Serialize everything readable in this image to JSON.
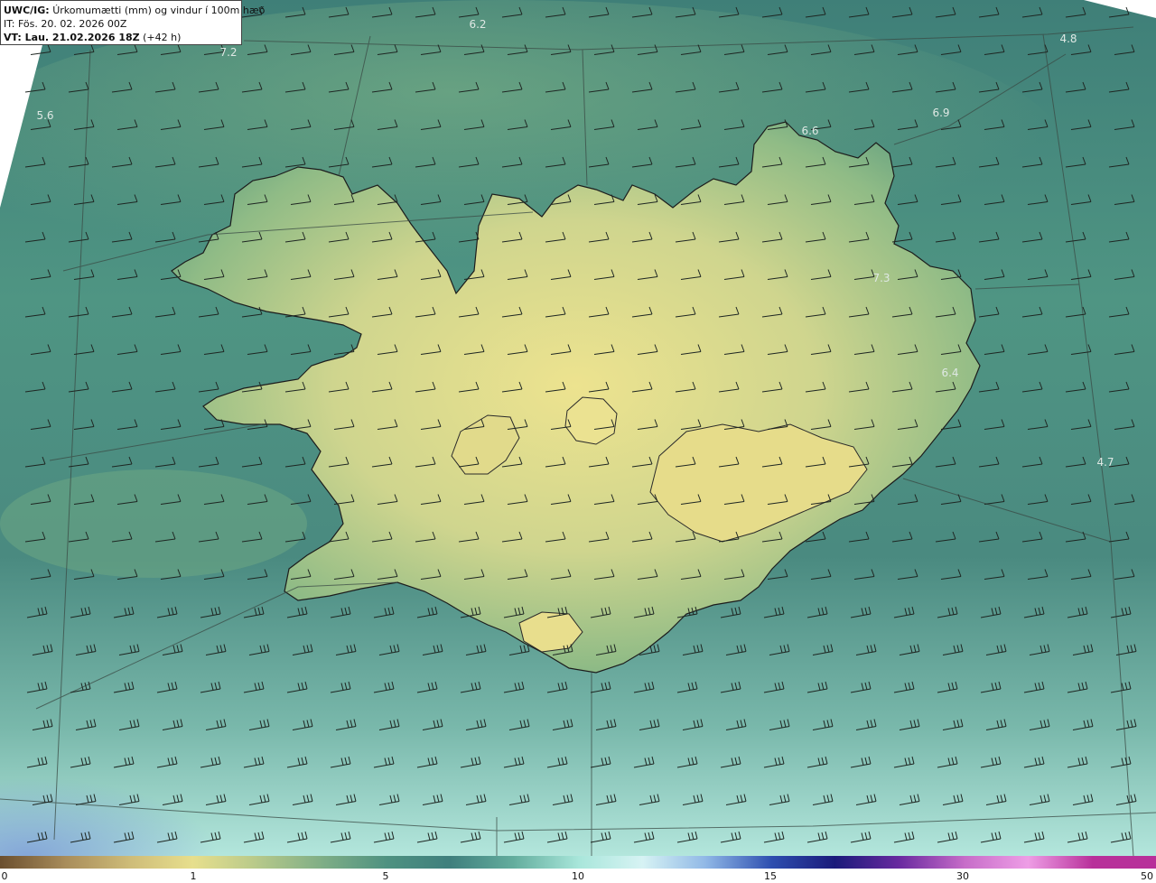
{
  "header": {
    "product_code": "UWC/IG:",
    "title": "Úrkomumætti (mm) og vindur í 100m hæð",
    "issue_time": "IT: Fös. 20. 02. 2026 00Z",
    "valid_prefix": "VT: Lau. 21.02.2026 18Z",
    "valid_suffix": "(+42 h)"
  },
  "value_labels": [
    "6.2",
    "4.8",
    "7.2",
    "5.6",
    "6.9",
    "6.6",
    "7.3",
    "6.4",
    "4.7"
  ],
  "colorbar": {
    "ticks": [
      "0",
      "1",
      "5",
      "10",
      "15",
      "30",
      "50"
    ],
    "colors": [
      "#6b4f2f",
      "#a88c5a",
      "#cdbb78",
      "#e7df8d",
      "#b7c98a",
      "#7fae86",
      "#4f9281",
      "#3f7f7d",
      "#64ae9e",
      "#a8e6da",
      "#d7f3f4",
      "#8fb7e6",
      "#2e4fb0",
      "#1a1a7a",
      "#6a2aa0",
      "#c66cc8",
      "#ee9ee6",
      "#b8309a"
    ]
  },
  "colors": {
    "sea": "#4f8a7e",
    "land_light": "#e5dd8d",
    "land_mid": "#b7c98a",
    "coast_line": "#1c1c1c",
    "graticule": "#3a4a44",
    "barb": "#1e2622"
  }
}
